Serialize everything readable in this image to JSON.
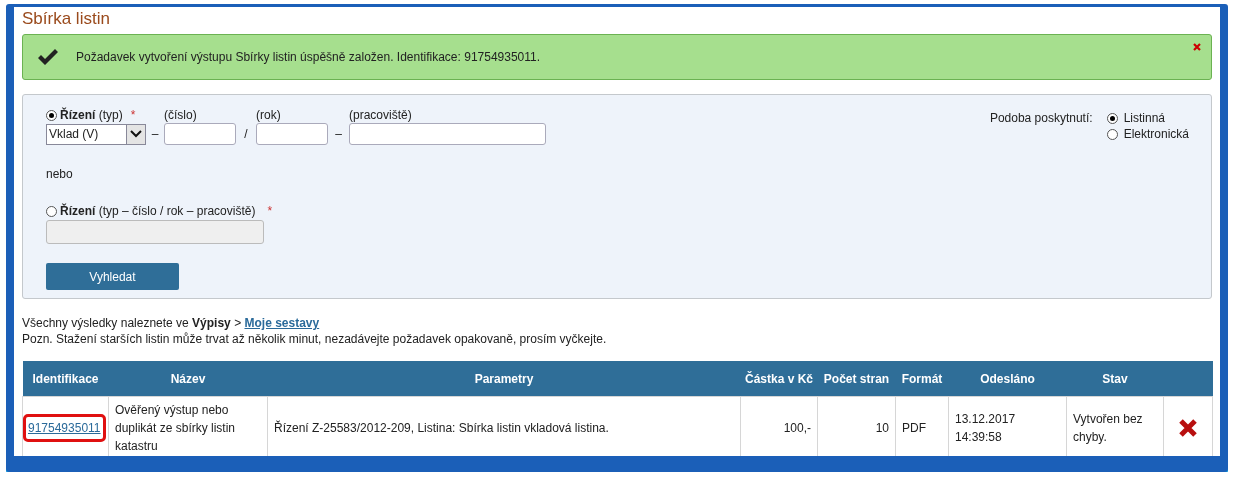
{
  "page": {
    "title": "Sbírka listin"
  },
  "alert": {
    "message": "Požadavek vytvoření výstupu Sbírky listin úspěšně založen. Identifikace: 91754935011."
  },
  "form": {
    "procedure_split": {
      "selected": true,
      "label": "**Řízení** (typ)",
      "required_mark": "*",
      "type_select": {
        "value": "Vklad (V)"
      },
      "number_label": "(číslo)",
      "year_label": "(rok)",
      "workplace_label": "(pracoviště)",
      "separators": [
        "–",
        "/",
        "–"
      ]
    },
    "or_text": "nebo",
    "procedure_full": {
      "selected": false,
      "label": "**Řízení** (typ – číslo / rok – pracoviště)",
      "required_mark": "*",
      "disabled": true
    },
    "search_button": "Vyhledat",
    "delivery": {
      "label": "Podoba poskytnutí:",
      "options": [
        {
          "label": "Listinná",
          "selected": true
        },
        {
          "label": "Elektronická",
          "selected": false
        }
      ]
    }
  },
  "info": {
    "results_text": "Všechny výsledky naleznete ve **Výpisy** >",
    "results_link": "Moje sestavy",
    "note": "Pozn. Stažení starších listin může trvat až několik minut, nezadávejte požadavek opakovaně, prosím vyčkejte."
  },
  "table": {
    "columns": [
      "Identifikace",
      "Název",
      "Parametry",
      "Částka v Kč",
      "Počet stran",
      "Formát",
      "Odesláno",
      "Stav"
    ],
    "rows": [
      {
        "id": "91754935011",
        "highlighted": true,
        "name": "Ověřený výstup nebo duplikát ze sbírky listin katastru",
        "params": "Řízení Z-25583/2012-209, Listina: Sbírka listin vkladová listina.",
        "amount": "100,-",
        "pages": "10",
        "format": "PDF",
        "sent": "13.12.2017 14:39:58",
        "status": "Vytvořen bez chyby."
      }
    ]
  }
}
